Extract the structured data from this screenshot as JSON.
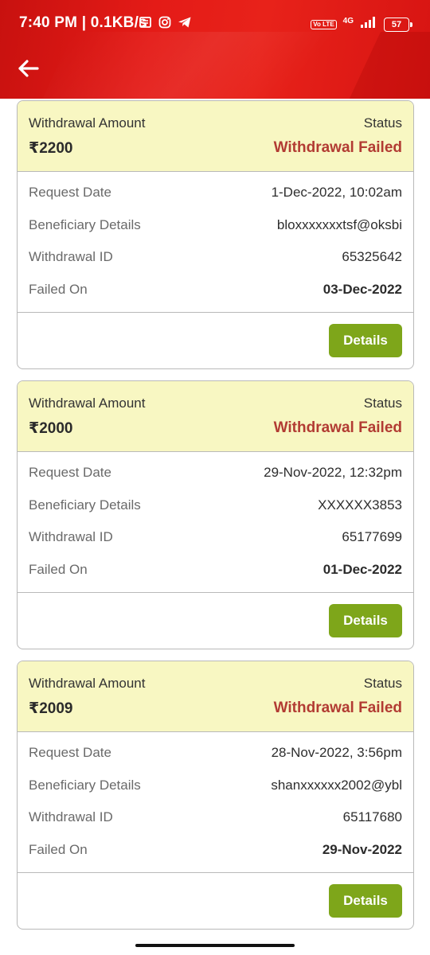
{
  "status_bar": {
    "time": "7:40 PM",
    "separator": "|",
    "speed": "0.1KB/s",
    "volte_label": "Vo LTE",
    "network": "4G",
    "battery": "57",
    "icons": [
      "news-icon",
      "instagram-icon",
      "telegram-icon",
      "volte-icon",
      "signal-icon",
      "battery-icon"
    ]
  },
  "header": {
    "back_icon": "arrow-left-icon",
    "colors": {
      "primary": "#e41b17",
      "dark": "#c8110f"
    }
  },
  "theme": {
    "card_head_bg": "#f8f7c2",
    "failed_color": "#b23b33",
    "button_color": "#7ea61a"
  },
  "labels": {
    "withdrawal_amount": "Withdrawal Amount",
    "status": "Status",
    "request_date": "Request Date",
    "beneficiary_details": "Beneficiary Details",
    "withdrawal_id": "Withdrawal ID",
    "failed_on": "Failed On",
    "details_button": "Details"
  },
  "withdrawals": [
    {
      "amount": "₹2200",
      "status": "Withdrawal Failed",
      "request_date": "1-Dec-2022, 10:02am",
      "beneficiary": "bloxxxxxxxtsf@oksbi",
      "withdrawal_id": "65325642",
      "failed_on": "03-Dec-2022"
    },
    {
      "amount": "₹2000",
      "status": "Withdrawal Failed",
      "request_date": "29-Nov-2022, 12:32pm",
      "beneficiary": "XXXXXX3853",
      "withdrawal_id": "65177699",
      "failed_on": "01-Dec-2022"
    },
    {
      "amount": "₹2009",
      "status": "Withdrawal Failed",
      "request_date": "28-Nov-2022, 3:56pm",
      "beneficiary": "shanxxxxxx2002@ybl",
      "withdrawal_id": "65117680",
      "failed_on": "29-Nov-2022"
    }
  ]
}
